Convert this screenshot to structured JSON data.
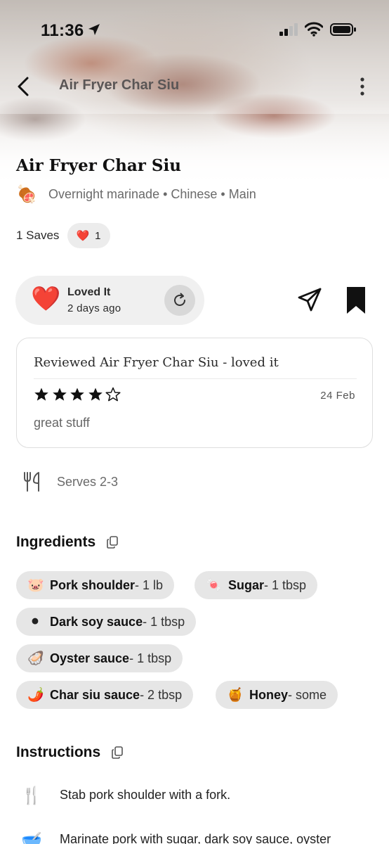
{
  "status_bar": {
    "time": "11:36"
  },
  "nav": {
    "title": "Air Fryer Char Siu"
  },
  "recipe": {
    "title": "Air Fryer Char Siu",
    "meta_emoji": "🍖",
    "meta": "Overnight marinade • Chinese • Main",
    "saves_label": "1 Saves",
    "reaction": {
      "emoji": "❤️",
      "count": "1"
    }
  },
  "loved": {
    "emoji": "❤️",
    "title": "Loved It",
    "subtitle": "2 days ago"
  },
  "review": {
    "title": "Reviewed Air Fryer Char Siu - loved it",
    "rating": 4,
    "rating_max": 5,
    "date": "24 Feb",
    "body": "great stuff"
  },
  "serves": {
    "label": "Serves 2-3"
  },
  "ingredients": {
    "title": "Ingredients",
    "items": [
      {
        "emoji": "🐷",
        "name": "Pork shoulder",
        "qty": " - 1 lb"
      },
      {
        "emoji": "🍬",
        "name": "Sugar",
        "qty": " - 1 tbsp"
      },
      {
        "emoji": "⚫",
        "name": "Dark soy sauce",
        "qty": " - 1 tbsp"
      },
      {
        "emoji": "🦪",
        "name": "Oyster sauce",
        "qty": " - 1 tbsp"
      },
      {
        "emoji": "🌶️",
        "name": "Char siu sauce",
        "qty": " - 2 tbsp"
      },
      {
        "emoji": "🍯",
        "name": "Honey",
        "qty": " - some"
      }
    ]
  },
  "instructions": {
    "title": "Instructions",
    "steps": [
      {
        "emoji": "🍴",
        "text": "Stab pork shoulder with a fork."
      },
      {
        "emoji": "🥣",
        "text": "Marinate pork with sugar, dark soy sauce, oyster"
      }
    ]
  },
  "icons": {
    "back": "chevron-left-icon",
    "more": "more-vertical-icon",
    "reload": "refresh-icon",
    "send": "send-icon",
    "bookmark": "bookmark-icon",
    "utensils": "utensils-icon",
    "copy": "copy-icon"
  },
  "colors": {
    "heart": "#e0201e",
    "chip_bg": "#e6e6e6",
    "card_bg": "#f0f0f0"
  }
}
